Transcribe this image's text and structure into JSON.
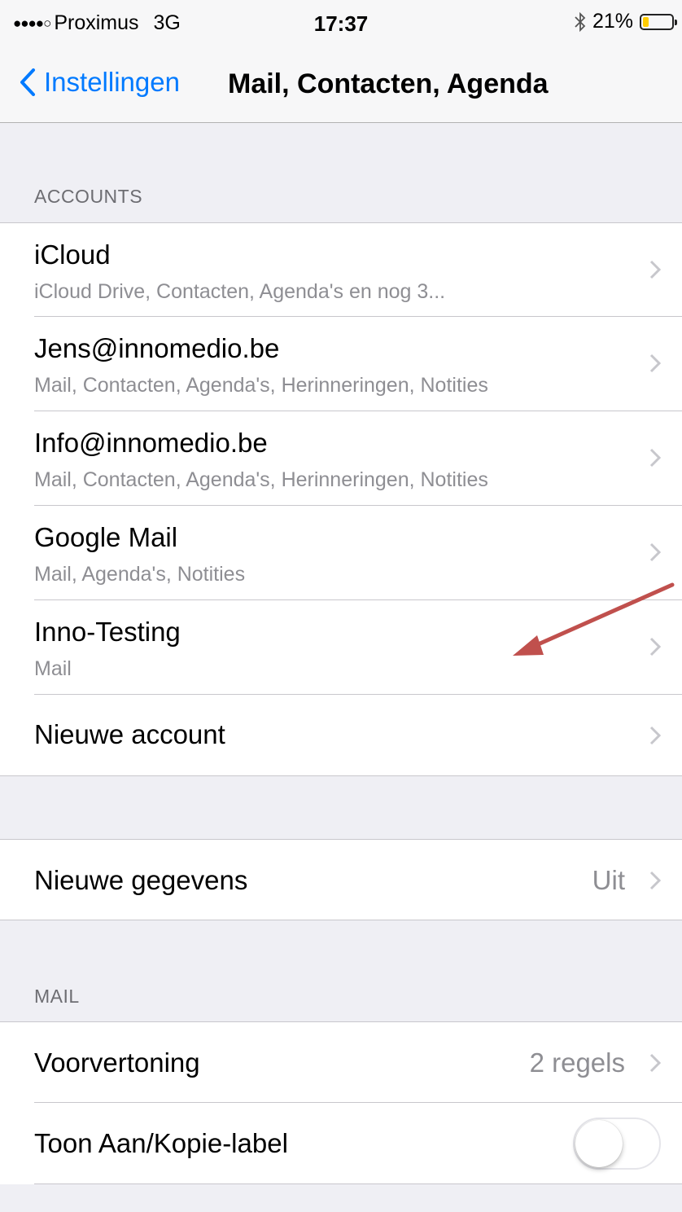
{
  "status": {
    "signal_dots": "●●●●○",
    "carrier": "Proximus",
    "network": "3G",
    "time": "17:37",
    "bluetooth_icon": "bluetooth-icon",
    "battery": "21%",
    "battery_level": 0.21,
    "battery_color": "#ffcc00"
  },
  "nav": {
    "back_label": "Instellingen",
    "title": "Mail, Contacten, Agenda"
  },
  "accounts": {
    "header": "ACCOUNTS",
    "items": [
      {
        "title": "iCloud",
        "subtitle": "iCloud Drive, Contacten, Agenda's en nog 3..."
      },
      {
        "title": "Jens@innomedio.be",
        "subtitle": "Mail, Contacten, Agenda's, Herinneringen, Notities"
      },
      {
        "title": "Info@innomedio.be",
        "subtitle": "Mail, Contacten, Agenda's, Herinneringen, Notities"
      },
      {
        "title": "Google Mail",
        "subtitle": "Mail, Agenda's, Notities"
      },
      {
        "title": "Inno-Testing",
        "subtitle": "Mail"
      }
    ],
    "new_account": "Nieuwe account"
  },
  "fetch": {
    "label": "Nieuwe gegevens",
    "value": "Uit"
  },
  "mail": {
    "header": "MAIL",
    "preview_label": "Voorvertoning",
    "preview_value": "2 regels",
    "show_label": "Toon Aan/Kopie-label",
    "show_enabled": false
  },
  "colors": {
    "accent": "#007aff",
    "annotation_arrow": "#c0504d"
  }
}
